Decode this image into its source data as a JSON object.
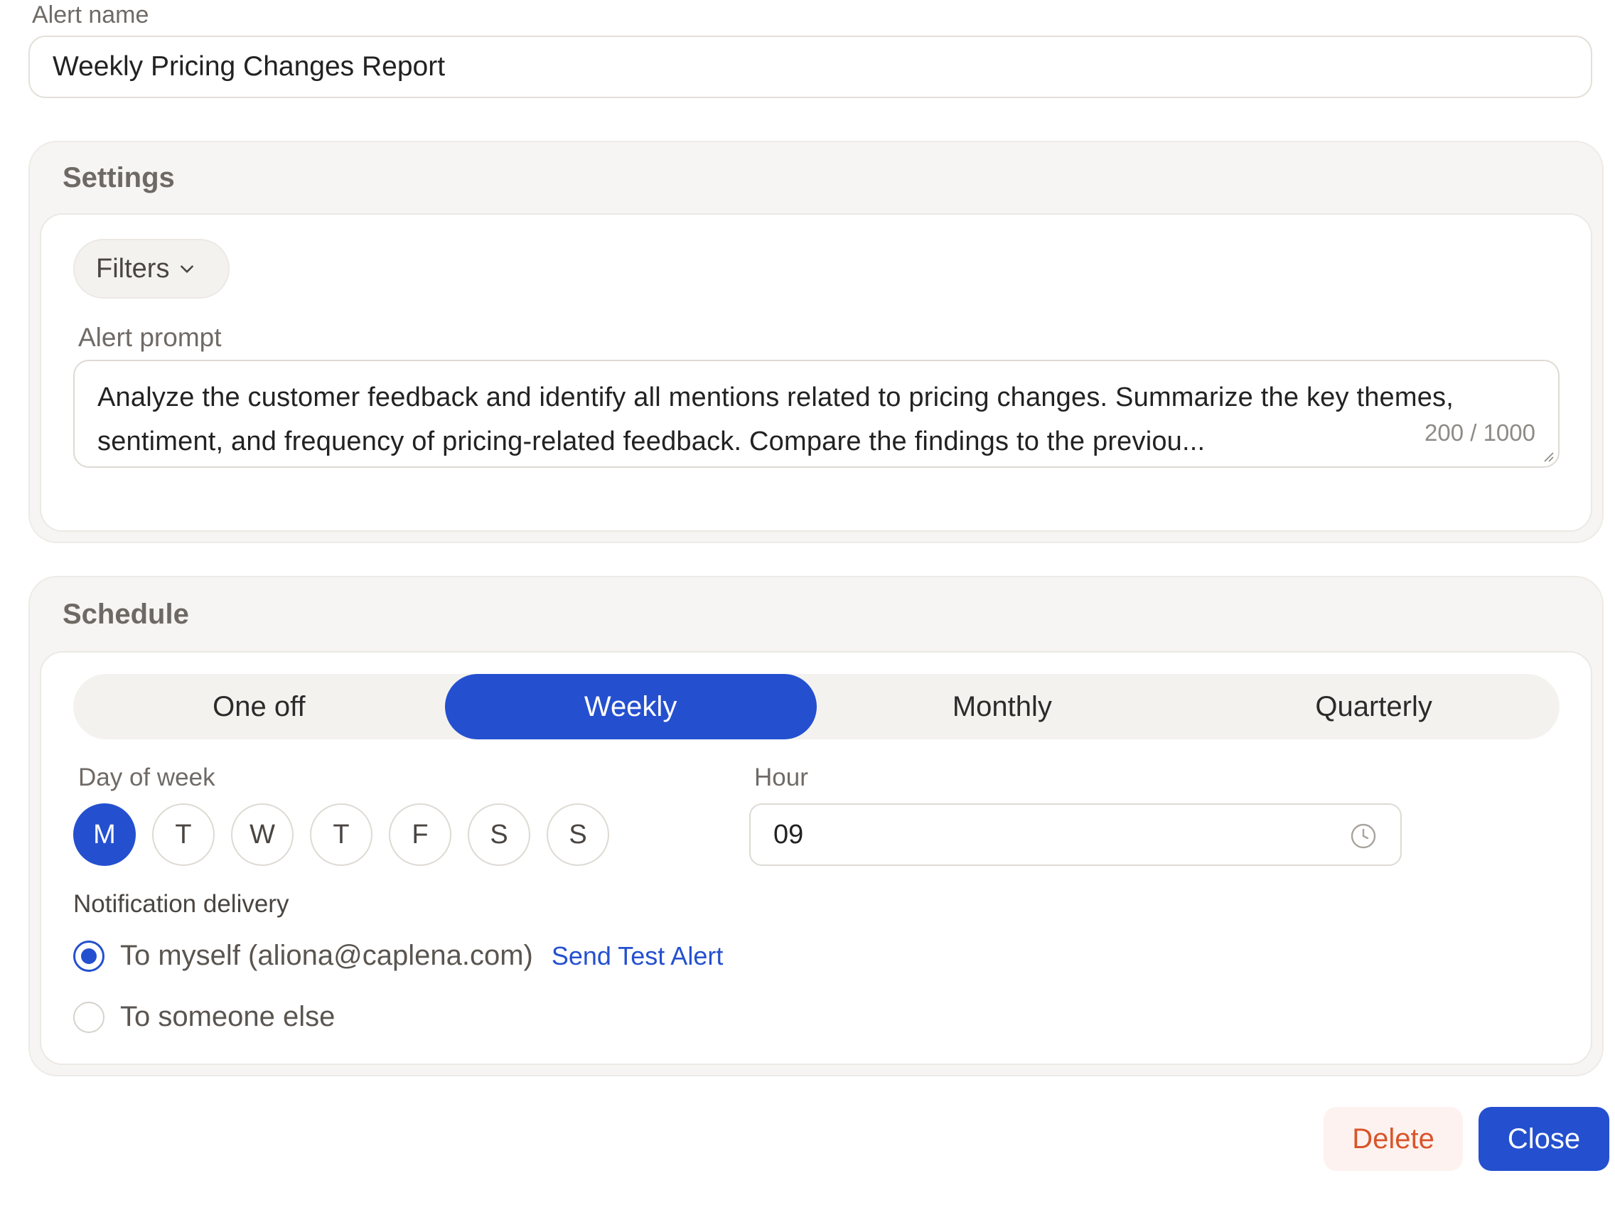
{
  "alert_name": {
    "label": "Alert name",
    "value": "Weekly Pricing Changes Report"
  },
  "settings": {
    "title": "Settings",
    "filters_label": "Filters",
    "prompt_label": "Alert prompt",
    "prompt_value": "Analyze the customer feedback and identify all mentions related to pricing changes. Summarize the key themes, sentiment, and frequency of pricing-related feedback. Compare the findings to the previou...",
    "char_counter": "200 / 1000"
  },
  "schedule": {
    "title": "Schedule",
    "frequency_tabs": [
      {
        "label": "One off",
        "active": false
      },
      {
        "label": "Weekly",
        "active": true
      },
      {
        "label": "Monthly",
        "active": false
      },
      {
        "label": "Quarterly",
        "active": false
      }
    ],
    "day_of_week_label": "Day of week",
    "days": [
      {
        "label": "M",
        "active": true
      },
      {
        "label": "T",
        "active": false
      },
      {
        "label": "W",
        "active": false
      },
      {
        "label": "T",
        "active": false
      },
      {
        "label": "F",
        "active": false
      },
      {
        "label": "S",
        "active": false
      },
      {
        "label": "S",
        "active": false
      }
    ],
    "hour_label": "Hour",
    "hour_value": "09",
    "notification_label": "Notification delivery",
    "delivery_options": [
      {
        "label": "To myself (aliona@caplena.com)",
        "checked": true
      },
      {
        "label": "To someone else",
        "checked": false
      }
    ],
    "send_test_label": "Send Test Alert"
  },
  "footer": {
    "delete_label": "Delete",
    "close_label": "Close"
  },
  "colors": {
    "accent": "#2450cf",
    "danger": "#d9542b",
    "card_bg": "#f6f5f3"
  },
  "icons": [
    "chevron-down-icon",
    "clock-icon",
    "resize-handle-icon"
  ]
}
